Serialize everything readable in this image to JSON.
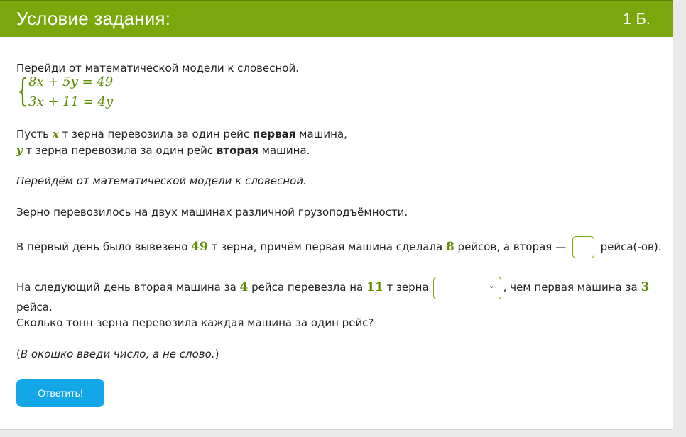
{
  "header": {
    "title": "Условие задания:",
    "points": "1 Б."
  },
  "task": {
    "intro": "Перейди от математической модели к словесной.",
    "system": {
      "eq1": "8x + 5y = 49",
      "eq2": "3x + 11 = 4y"
    },
    "let_line1": {
      "prefix": "Пусть ",
      "var": "x",
      "middle": " т зерна перевозила за один рейс ",
      "bold": "первая",
      "suffix": " машина,"
    },
    "let_line2": {
      "var": "y",
      "middle": " т зерна перевозила за один рейс ",
      "bold": "вторая",
      "suffix": " машина."
    },
    "transition": "Перейдём от математической модели к словесной.",
    "statement": "Зерно перевозилось на двух машинах различной грузоподъёмности.",
    "day1": {
      "text1": "В первый день было вывезено ",
      "num1": "49",
      "text2": " т зерна, причём первая машина сделала ",
      "num2": "8",
      "text3": " рейсов, а вторая — ",
      "text4": " рейса(-ов)."
    },
    "day2": {
      "text1": "На следующий день вторая машина за ",
      "num1": "4",
      "text2": " рейса перевезла на ",
      "num2": "11",
      "text3": " т зерна",
      "text4": ", чем первая машина за ",
      "num3": "3",
      "line2": "рейса."
    },
    "question": "Сколько тонн зерна перевозила каждая машина за один рейс?",
    "hint": {
      "open": "(",
      "italic": "В окошко введи число, а не слово.",
      "close": ")"
    },
    "input_value": "",
    "select_value": "",
    "chevron_icon": "chevron-down-icon"
  },
  "buttons": {
    "answer": "Ответить!"
  },
  "colors": {
    "header_bg": "#7aa80c",
    "math_green": "#5e8a00",
    "button_bg": "#13a7e8"
  }
}
